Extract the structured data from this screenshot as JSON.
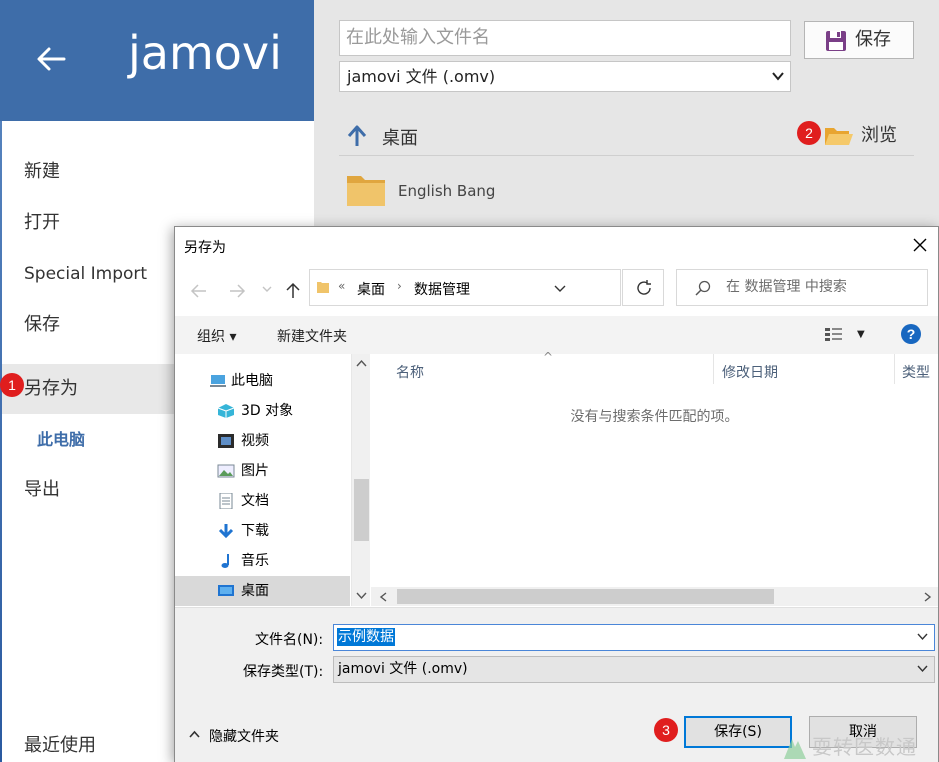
{
  "app": {
    "logo_text": "jamovi"
  },
  "sidebar": {
    "items": [
      {
        "label": "新建"
      },
      {
        "label": "打开"
      },
      {
        "label": "Special Import"
      },
      {
        "label": "保存"
      },
      {
        "label": "另存为"
      },
      {
        "label": "导出"
      },
      {
        "label": "最近使用"
      }
    ],
    "sub_item": "此电脑"
  },
  "save_panel": {
    "filename_placeholder": "在此处输入文件名",
    "file_type": "jamovi 文件 (.omv)",
    "save_label": "保存",
    "location": "桌面",
    "browse_label": "浏览",
    "folders": [
      {
        "name": "English Bang"
      }
    ]
  },
  "badges": [
    "1",
    "2",
    "3"
  ],
  "dialog": {
    "title": "另存为",
    "breadcrumb": [
      "«",
      "桌面",
      "数据管理"
    ],
    "search_placeholder": "在 数据管理 中搜索",
    "toolbar": {
      "organize": "组织 ▾",
      "new_folder": "新建文件夹",
      "help": "?"
    },
    "tree": [
      {
        "label": "此电脑",
        "icon": "computer-icon"
      },
      {
        "label": "3D 对象",
        "icon": "3d-objects-icon"
      },
      {
        "label": "视频",
        "icon": "video-icon"
      },
      {
        "label": "图片",
        "icon": "pictures-icon"
      },
      {
        "label": "文档",
        "icon": "documents-icon"
      },
      {
        "label": "下载",
        "icon": "downloads-icon"
      },
      {
        "label": "音乐",
        "icon": "music-icon"
      },
      {
        "label": "桌面",
        "icon": "desktop-icon",
        "selected": true
      }
    ],
    "columns": [
      "名称",
      "修改日期",
      "类型"
    ],
    "empty_message": "没有与搜索条件匹配的项。",
    "filename_label": "文件名(N):",
    "filename_value": "示例数据",
    "filetype_label": "保存类型(T):",
    "filetype_value": "jamovi 文件 (.omv)",
    "hide_folders": "隐藏文件夹",
    "save_button": "保存(S)",
    "cancel_button": "取消"
  },
  "watermark": "耍转医数通",
  "colors": {
    "accent": "#3e6da9",
    "badge": "#e01e1e",
    "selection": "#0078d7"
  }
}
